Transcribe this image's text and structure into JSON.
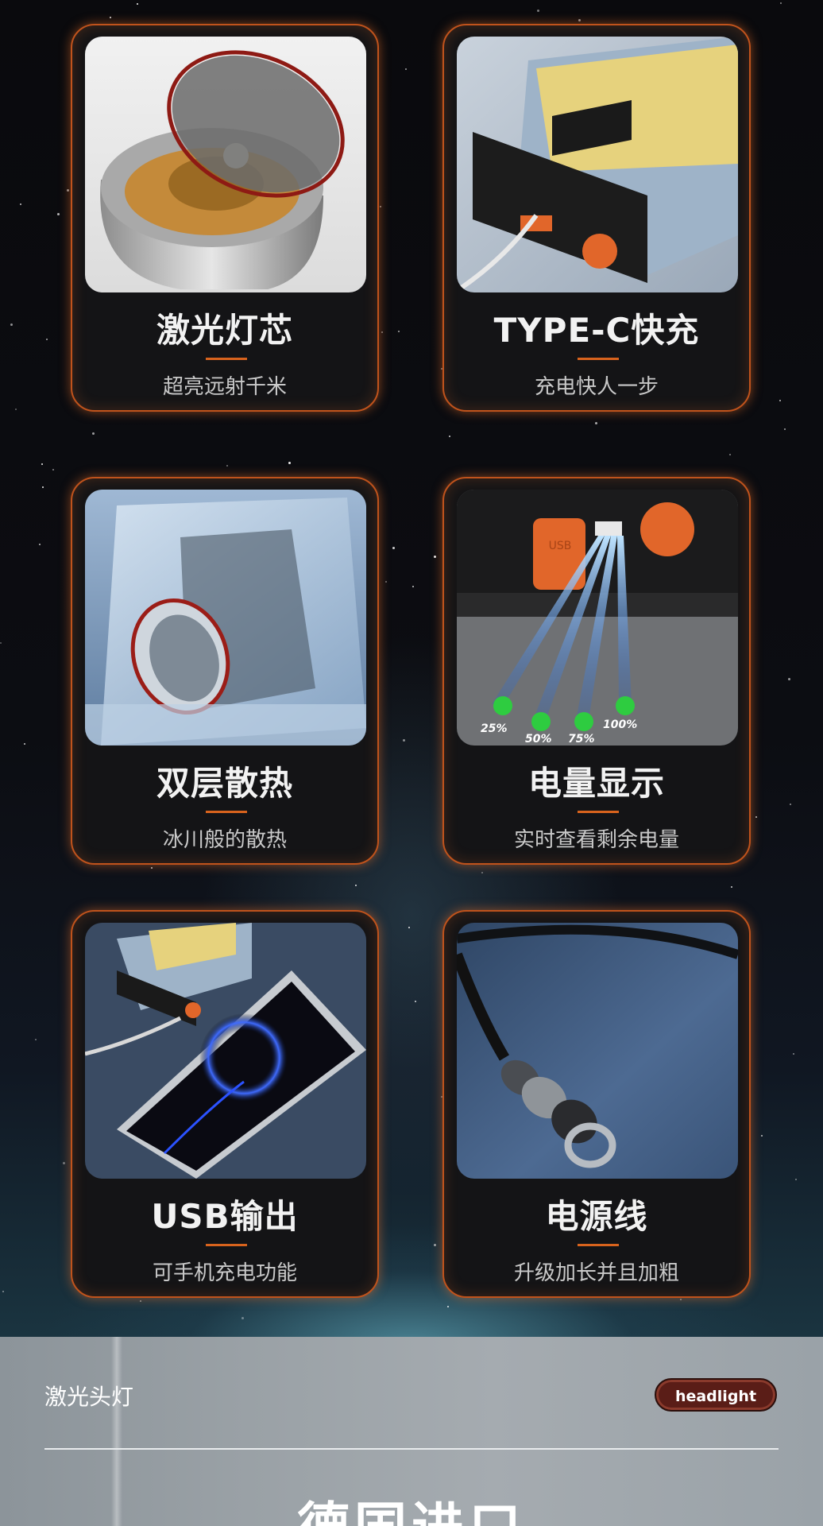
{
  "features": [
    {
      "title": "激光灯芯",
      "subtitle": "超亮远射千米",
      "icon": "laser-core-photo"
    },
    {
      "title": "TYPE-C快充",
      "subtitle": "充电快人一步",
      "icon": "type-c-charging-photo"
    },
    {
      "title": "双层散热",
      "subtitle": "冰川般的散热",
      "icon": "ice-cooling-photo"
    },
    {
      "title": "电量显示",
      "subtitle": "实时查看剩余电量",
      "icon": "battery-indicator-photo",
      "battery_levels": [
        "25%",
        "50%",
        "75%",
        "100%"
      ]
    },
    {
      "title": "USB输出",
      "subtitle": "可手机充电功能",
      "icon": "usb-output-photo"
    },
    {
      "title": "电源线",
      "subtitle": "升级加长并且加粗",
      "icon": "power-cable-photo"
    }
  ],
  "section": {
    "category": "激光头灯",
    "badge": "headlight",
    "heading": "德国进口"
  },
  "colors": {
    "accent": "#d8631d",
    "card_bg": "#141416",
    "indicator_green": "#2ecc40"
  }
}
